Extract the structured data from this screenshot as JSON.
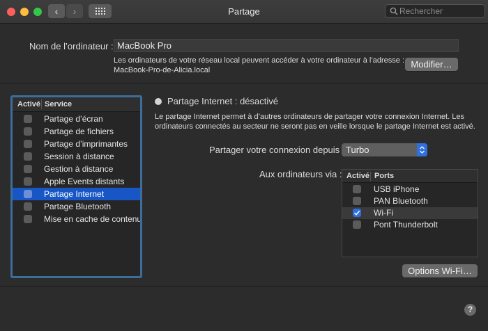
{
  "window": {
    "title": "Partage",
    "search_placeholder": "Rechercher",
    "nav_back": "‹",
    "nav_forward": "›",
    "traffic_colors": {
      "close": "#fc605b",
      "minimize": "#fdbc40",
      "zoom": "#34c84a"
    }
  },
  "computer": {
    "name_label": "Nom de l’ordinateur :",
    "name_value": "MacBook Pro",
    "info_line1": "Les ordinateurs de votre réseau local peuvent accéder à votre ordinateur à l’adresse :",
    "info_line2": "MacBook-Pro-de-Alicia.local",
    "modify_button": "Modifier…"
  },
  "services": {
    "col_active": "Activé",
    "col_service": "Service",
    "items": [
      {
        "label": "Partage d’écran",
        "checked": false
      },
      {
        "label": "Partage de fichiers",
        "checked": false
      },
      {
        "label": "Partage d’imprimantes",
        "checked": false
      },
      {
        "label": "Session à distance",
        "checked": false
      },
      {
        "label": "Gestion à distance",
        "checked": false
      },
      {
        "label": "Apple Events distants",
        "checked": false
      },
      {
        "label": "Partage Internet",
        "checked": false
      },
      {
        "label": "Partage Bluetooth",
        "checked": false
      },
      {
        "label": "Mise en cache de contenu",
        "checked": false
      }
    ],
    "selected_index": 6
  },
  "detail": {
    "status": "Partage Internet : désactivé",
    "desc_line1": "Le partage Internet permet à d’autres ordinateurs de partager votre connexion Internet. Les",
    "desc_line2": "ordinateurs connectés au secteur ne seront pas en veille lorsque le partage Internet est activé.",
    "share_from_label": "Partager votre connexion depuis :",
    "share_from_value": "Turbo",
    "to_computers_label": "Aux ordinateurs via :",
    "col_active": "Activé",
    "col_ports": "Ports",
    "ports": [
      {
        "label": "USB iPhone",
        "checked": false
      },
      {
        "label": "PAN Bluetooth",
        "checked": false
      },
      {
        "label": "Wi-Fi",
        "checked": true
      },
      {
        "label": "Pont Thunderbolt",
        "checked": false
      }
    ],
    "wifi_options_button": "Options Wi-Fi…"
  },
  "help": "?"
}
